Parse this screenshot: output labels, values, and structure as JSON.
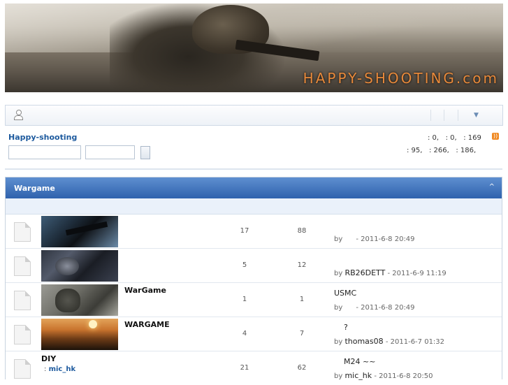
{
  "banner": {
    "brand": "HAPPY-SHOOTING.com"
  },
  "info": {
    "site_link": "Happy-shooting",
    "stats_line1": ": 0,   : 0,   : 169",
    "stats_line2": ": 95,   : 266,   : 186,"
  },
  "forum": {
    "title": "Wargame",
    "collapse_icon": "^",
    "rows": [
      {
        "title": "",
        "moderator_label": "",
        "moderator": "",
        "topics": "17",
        "posts": "88",
        "last_title": "",
        "last_by": "by",
        "last_user": "",
        "last_time": "- 2011-6-8 20:49"
      },
      {
        "title": "",
        "moderator_label": "",
        "moderator": "",
        "topics": "5",
        "posts": "12",
        "last_title": "",
        "last_by": "by",
        "last_user": "RB26DETT",
        "last_time": "- 2011-6-9 11:19"
      },
      {
        "title": "WarGame",
        "moderator_label": "",
        "moderator": "",
        "topics": "1",
        "posts": "1",
        "last_title": "USMC",
        "last_by": "by",
        "last_user": "",
        "last_time": "- 2011-6-8 20:49"
      },
      {
        "title": "WARGAME",
        "moderator_label": "",
        "moderator": "",
        "topics": "4",
        "posts": "7",
        "last_title": "?",
        "last_by": "by",
        "last_user": "thomas08",
        "last_time": "- 2011-6-7 01:32"
      },
      {
        "title": "DIY",
        "moderator_label": ":",
        "moderator": "mic_hk",
        "topics": "21",
        "posts": "62",
        "last_title": "M24    ~~",
        "last_by": "by",
        "last_user": "mic_hk",
        "last_time": "- 2011-6-8 20:50"
      }
    ]
  }
}
